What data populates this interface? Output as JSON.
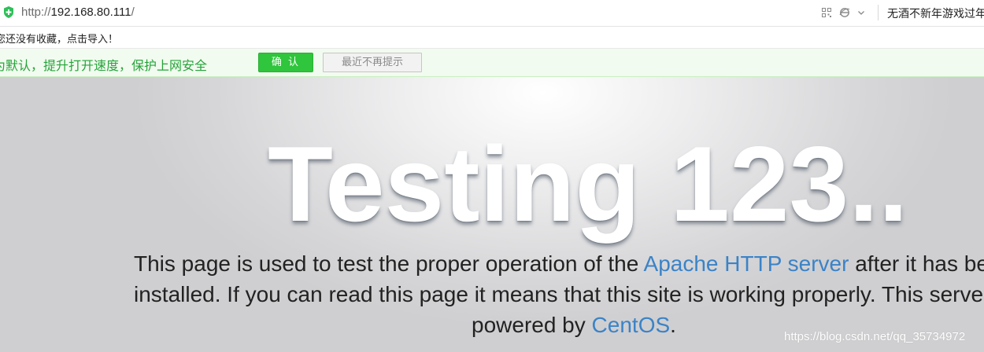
{
  "browser": {
    "url_protocol": "http://",
    "url_host": "192.168.80.111",
    "url_trailing": "/",
    "search_text": "无酒不新年游戏过年",
    "bookmark_message": "您还没有收藏，点击导入！",
    "notification": {
      "message": "为默认，提升打开速度，保护上网安全",
      "confirm_label": "确 认",
      "dismiss_label": "最近不再提示"
    }
  },
  "page": {
    "title": "Testing 123..",
    "line1_prefix": "This page is used to test the proper operation of the ",
    "line1_link": "Apache HTTP server",
    "line1_suffix": " after it has been",
    "line2": "installed. If you can read this page it means that this site is working properly. This server is",
    "line3_prefix": "powered by ",
    "line3_link": "CentOS",
    "line3_suffix": ".",
    "watermark": "https://blog.csdn.net/qq_35734972"
  },
  "colors": {
    "link": "#3b83c7",
    "notify_text": "#24a43a",
    "confirm_button": "#2fc53c"
  }
}
